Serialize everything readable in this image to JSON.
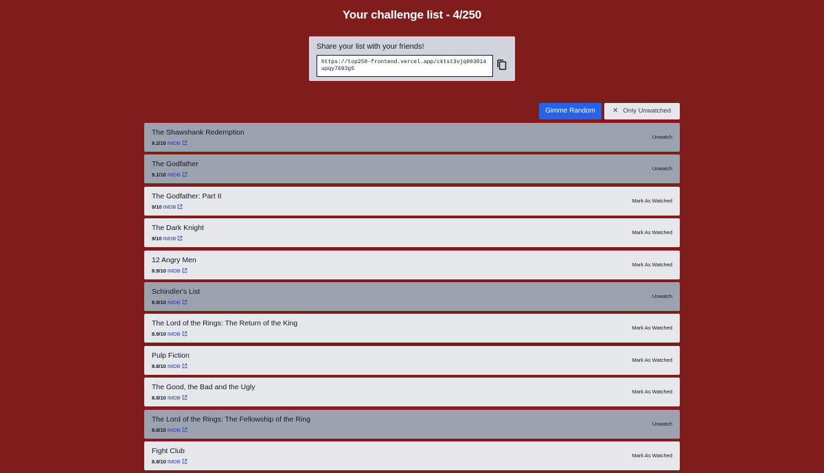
{
  "page": {
    "title": "Your challenge list - 4/250"
  },
  "share": {
    "label": "Share your list with your friends!",
    "url": "https://top250-frontend.vercel.app/cktst3vjq003014upqy7693g5",
    "copy_icon": "copy-icon"
  },
  "toolbar": {
    "random_label": "Gimme Random",
    "filter_label": "Only Unwatched",
    "filter_icon": "close-icon"
  },
  "colors": {
    "background": "#7f1d1d",
    "accent_button": "#2563eb",
    "watched_row": "#9ca3af",
    "unwatched_row": "#e5e7eb",
    "link": "#1e40af"
  },
  "movies": [
    {
      "title": "The Shawshank Redemption",
      "rating": "9.2/10",
      "link": "IMDB",
      "action": "Unwatch",
      "watched": true
    },
    {
      "title": "The Godfather",
      "rating": "9.1/10",
      "link": "IMDB",
      "action": "Unwatch",
      "watched": true
    },
    {
      "title": "The Godfather: Part II",
      "rating": "9/10",
      "link": "IMDB",
      "action": "Mark As Watched",
      "watched": false
    },
    {
      "title": "The Dark Knight",
      "rating": "9/10",
      "link": "IMDB",
      "action": "Mark As Watched",
      "watched": false
    },
    {
      "title": "12 Angry Men",
      "rating": "8.9/10",
      "link": "IMDB",
      "action": "Mark As Watched",
      "watched": false
    },
    {
      "title": "Schindler's List",
      "rating": "8.9/10",
      "link": "IMDB",
      "action": "Unwatch",
      "watched": true
    },
    {
      "title": "The Lord of the Rings: The Return of the King",
      "rating": "8.9/10",
      "link": "IMDB",
      "action": "Mark As Watched",
      "watched": false
    },
    {
      "title": "Pulp Fiction",
      "rating": "8.8/10",
      "link": "IMDB",
      "action": "Mark As Watched",
      "watched": false
    },
    {
      "title": "The Good, the Bad and the Ugly",
      "rating": "8.8/10",
      "link": "IMDB",
      "action": "Mark As Watched",
      "watched": false
    },
    {
      "title": "The Lord of the Rings: The Fellowship of the Ring",
      "rating": "8.8/10",
      "link": "IMDB",
      "action": "Unwatch",
      "watched": true
    },
    {
      "title": "Fight Club",
      "rating": "8.8/10",
      "link": "IMDB",
      "action": "Mark As Watched",
      "watched": false
    }
  ]
}
